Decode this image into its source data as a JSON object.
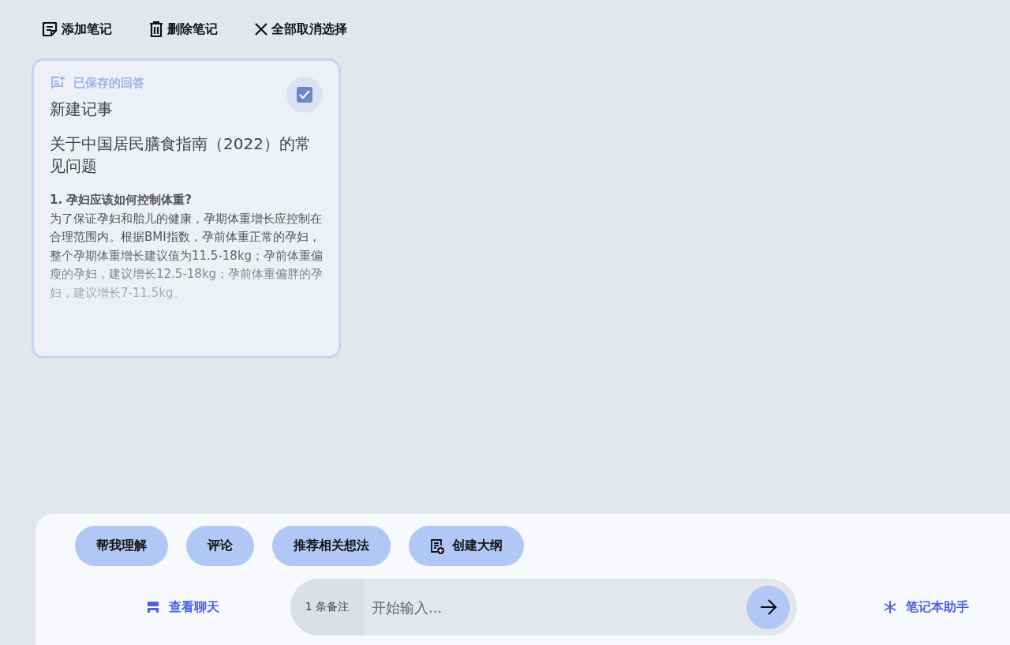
{
  "toolbar": [
    {
      "kind": "add",
      "label": "添加笔记"
    },
    {
      "kind": "delete",
      "label": "删除笔记"
    },
    {
      "kind": "deselect",
      "label": "全部取消选择"
    }
  ],
  "notes": [
    {
      "source": "已保存的回答",
      "title": "新建记事",
      "selected": true,
      "heading": "关于中国居民膳食指南（2022）的常见问题",
      "question": "1. 孕妇应该如何控制体重?",
      "body": "为了保证孕妇和胎儿的健康，孕期体重增长应控制在合理范围内。根据BMI指数，孕前体重正常的孕妇，整个孕期体重增长建议值为11.5-18kg；孕前体重偏瘦的孕妇，建议增长12.5-18kg；孕前体重偏胖的孕妇，建议增长7-11.5kg。"
    }
  ],
  "suggestions": [
    {
      "kind": "plain",
      "label": "帮我理解"
    },
    {
      "kind": "plain",
      "label": "评论"
    },
    {
      "kind": "plain",
      "label": "推荐相关想法"
    },
    {
      "kind": "outline",
      "label": "创建大纲"
    }
  ],
  "chat": {
    "view_chat": "查看聊天",
    "source_count": "1 条备注",
    "placeholder": "开始输入...",
    "assistant": "笔记本助手"
  }
}
